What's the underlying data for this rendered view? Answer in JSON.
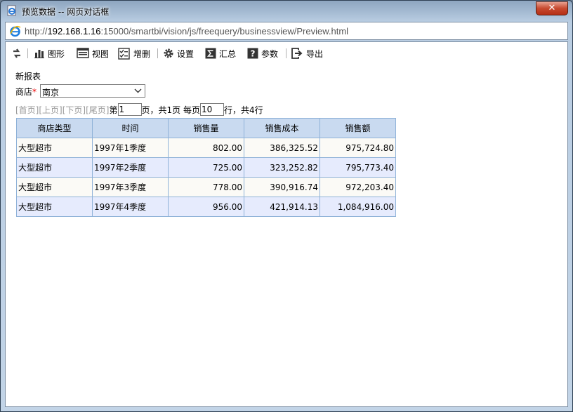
{
  "window": {
    "title": "预览数据 -- 网页对话框",
    "close_label": "✕"
  },
  "address": {
    "prefix": "http://",
    "host": "192.168.1.16",
    "rest": ":15000/smartbi/vision/js/freequery/businessview/Preview.html"
  },
  "toolbar": {
    "refresh_icon": "refresh-icon",
    "chart": "图形",
    "view": "视图",
    "add_delete": "增删",
    "settings": "设置",
    "summary": "汇总",
    "params": "参数",
    "export": "导出"
  },
  "report": {
    "title": "新报表"
  },
  "filter": {
    "label": "商店",
    "required_mark": "*",
    "value": "南京"
  },
  "pager": {
    "first": "[首页]",
    "prev": "[上页]",
    "next": "[下页]",
    "last": "[尾页]",
    "page_prefix": " 第",
    "page_value": "1",
    "page_suffix": "页，共1页 每页",
    "page_size_value": "10",
    "rows_suffix": "行，共4行"
  },
  "table": {
    "headers": [
      "商店类型",
      "时间",
      "销售量",
      "销售成本",
      "销售额"
    ],
    "rows": [
      [
        "大型超市",
        "1997年1季度",
        "802.00",
        "386,325.52",
        "975,724.80"
      ],
      [
        "大型超市",
        "1997年2季度",
        "725.00",
        "323,252.82",
        "795,773.40"
      ],
      [
        "大型超市",
        "1997年3季度",
        "778.00",
        "390,916.74",
        "972,203.40"
      ],
      [
        "大型超市",
        "1997年4季度",
        "956.00",
        "421,914.13",
        "1,084,916.00"
      ]
    ]
  },
  "colors": {
    "header_bg": "#c9daf0",
    "row_odd": "#fbfaf6",
    "row_even": "#e6ebfd",
    "grid_border": "#8fb2d8"
  }
}
